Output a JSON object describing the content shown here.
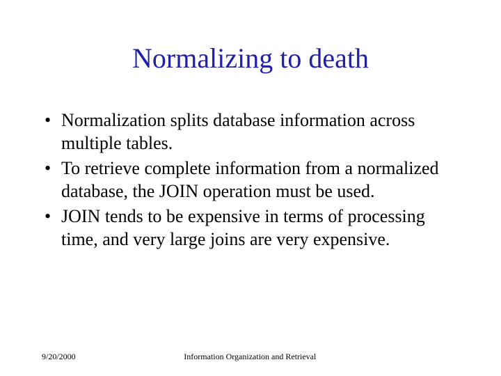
{
  "title": "Normalizing to death",
  "bullets": [
    "Normalization splits database information across multiple tables.",
    "To retrieve complete information from a normalized database, the JOIN operation must be used.",
    "JOIN tends to be expensive in terms of processing time, and very large joins are very expensive."
  ],
  "footer": {
    "date": "9/20/2000",
    "course": "Information Organization and Retrieval"
  }
}
